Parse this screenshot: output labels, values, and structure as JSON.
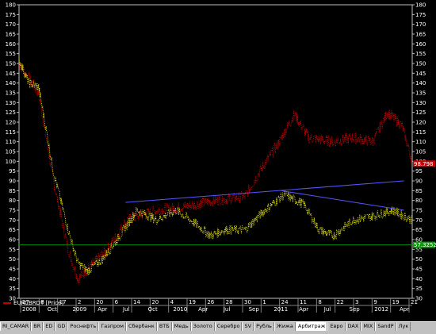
{
  "chart_data": {
    "type": "line",
    "series": [
      {
        "name": "EURCBRDT [Price]",
        "color": "#cc0000"
      },
      {
        "color": "#e6e600"
      }
    ],
    "last_values": {
      "red": "98.798",
      "yellow": "57.3252"
    },
    "ylim": [
      30,
      180
    ],
    "yticks": [
      30,
      35,
      40,
      45,
      50,
      55,
      60,
      65,
      70,
      75,
      80,
      85,
      90,
      95,
      100,
      105,
      110,
      115,
      120,
      125,
      130,
      135,
      140,
      145,
      150,
      155,
      160,
      165,
      170,
      175,
      180
    ],
    "x_top_labels": [
      "27",
      "8",
      "17",
      "2",
      "20",
      "6",
      "14",
      "20",
      "4",
      "19",
      "26",
      "28",
      "30",
      "1",
      "24",
      "11",
      "8",
      "22",
      "3",
      "9",
      "19",
      "21"
    ],
    "x_bottom_labels": [
      "2008",
      "Oct",
      "2009",
      "Apr",
      "Jul",
      "Oct",
      "2010",
      "Apr",
      "Jul",
      "Sep",
      "2011",
      "Apr",
      "Jul",
      "Sep",
      "2012",
      "Apr"
    ],
    "grid": false,
    "trendlines": [
      {
        "color": "#5555ff",
        "from": [
          "2009-08",
          79
        ],
        "to": [
          "2012-06",
          90
        ]
      },
      {
        "color": "#5555ff",
        "from": [
          "2011-03",
          85
        ],
        "to": [
          "2012-06",
          75
        ]
      }
    ],
    "horizontal_line": {
      "value": 57.3252,
      "color": "#008800"
    }
  },
  "legend_label": "EURCBRDT [Price]",
  "tabs": [
    {
      "label": "RI_CAMAR",
      "active": false
    },
    {
      "label": "BR",
      "active": false
    },
    {
      "label": "ED",
      "active": false
    },
    {
      "label": "GD",
      "active": false
    },
    {
      "label": "Роснефть",
      "active": false
    },
    {
      "label": "Газпром",
      "active": false
    },
    {
      "label": "Сбербанк",
      "active": false
    },
    {
      "label": "ВТБ",
      "active": false
    },
    {
      "label": "Медь",
      "active": false
    },
    {
      "label": "Золото",
      "active": false
    },
    {
      "label": "Серебро",
      "active": false
    },
    {
      "label": "SV",
      "active": false
    },
    {
      "label": "Рубль",
      "active": false
    },
    {
      "label": "Жижа",
      "active": false
    },
    {
      "label": "Арбитраж",
      "active": true
    },
    {
      "label": "Евро",
      "active": false
    },
    {
      "label": "DAX",
      "active": false
    },
    {
      "label": "MIX",
      "active": false
    },
    {
      "label": "SandP",
      "active": false
    },
    {
      "label": "Лук",
      "active": false
    }
  ]
}
